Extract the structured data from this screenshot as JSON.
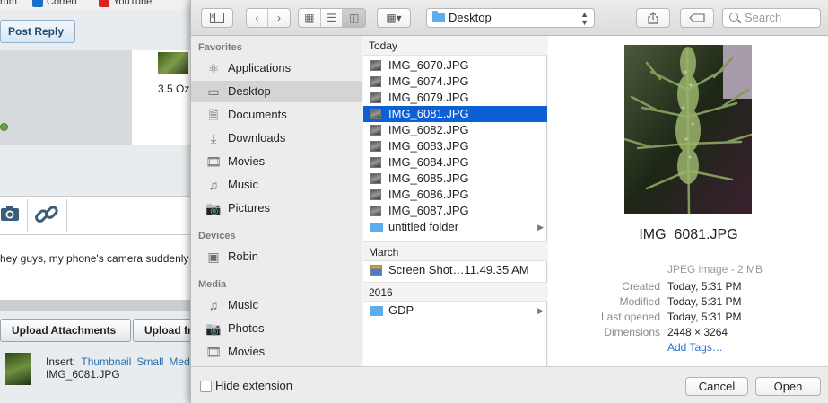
{
  "browser": {
    "bookmarks": [
      "rum",
      "Correo",
      "YouTube"
    ]
  },
  "page": {
    "post_reply": "Post Reply",
    "product_text": "3.5 Oz",
    "editor_text": "hey guys, my phone's camera suddenly",
    "upload_attachments": "Upload Attachments",
    "upload_from": "Upload fr",
    "insert_label": "Insert:",
    "insert_links": [
      "Thumbnail",
      "Small",
      "Med"
    ],
    "attachment_name": "IMG_6081.JPG"
  },
  "dialog": {
    "location": "Desktop",
    "search_placeholder": "Search",
    "sidebar": {
      "favorites_heading": "Favorites",
      "favorites": [
        {
          "label": "Applications",
          "icon": "applications-icon"
        },
        {
          "label": "Desktop",
          "icon": "desktop-icon",
          "selected": true
        },
        {
          "label": "Documents",
          "icon": "documents-icon"
        },
        {
          "label": "Downloads",
          "icon": "downloads-icon"
        },
        {
          "label": "Movies",
          "icon": "movies-icon"
        },
        {
          "label": "Music",
          "icon": "music-icon"
        },
        {
          "label": "Pictures",
          "icon": "pictures-icon"
        }
      ],
      "devices_heading": "Devices",
      "devices": [
        {
          "label": "Robin",
          "icon": "disk-icon"
        }
      ],
      "media_heading": "Media",
      "media": [
        {
          "label": "Music",
          "icon": "music-icon"
        },
        {
          "label": "Photos",
          "icon": "photos-icon"
        },
        {
          "label": "Movies",
          "icon": "movies-icon"
        }
      ]
    },
    "groups": {
      "today": "Today",
      "march": "March",
      "y2016": "2016"
    },
    "today_files": [
      "IMG_6070.JPG",
      "IMG_6074.JPG",
      "IMG_6079.JPG",
      "IMG_6081.JPG",
      "IMG_6082.JPG",
      "IMG_6083.JPG",
      "IMG_6084.JPG",
      "IMG_6085.JPG",
      "IMG_6086.JPG",
      "IMG_6087.JPG"
    ],
    "selected_file": "IMG_6081.JPG",
    "today_folder": "untitled folder",
    "march_file": "Screen Shot…11.49.35 AM",
    "folder_2016": "GDP",
    "preview": {
      "name": "IMG_6081.JPG",
      "kind": "JPEG image - 2 MB",
      "meta": [
        {
          "label": "Created",
          "value": "Today, 5:31 PM"
        },
        {
          "label": "Modified",
          "value": "Today, 5:31 PM"
        },
        {
          "label": "Last opened",
          "value": "Today, 5:31 PM"
        },
        {
          "label": "Dimensions",
          "value": "2448 × 3264"
        }
      ],
      "add_tags": "Add Tags…"
    },
    "footer": {
      "hide_extension": "Hide extension",
      "cancel": "Cancel",
      "open": "Open"
    },
    "colors": {
      "selection": "#0d5fd6",
      "folder": "#5aaef0",
      "link": "#2a6fd6"
    }
  }
}
